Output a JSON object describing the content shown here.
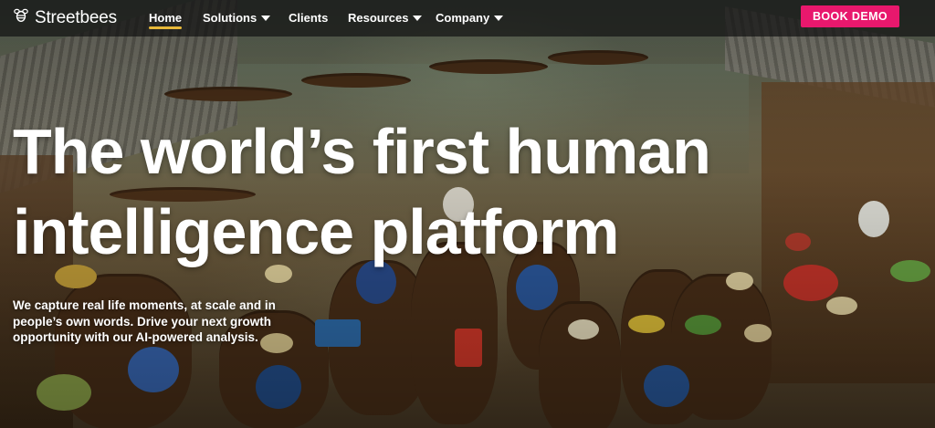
{
  "brand": {
    "name": "Streetbees",
    "logo_icon": "bee-icon"
  },
  "nav": {
    "items": [
      {
        "label": "Home",
        "active": true,
        "dropdown": false
      },
      {
        "label": "Solutions",
        "active": false,
        "dropdown": true
      },
      {
        "label": "Clients",
        "active": false,
        "dropdown": false
      },
      {
        "label": "Resources",
        "active": false,
        "dropdown": true
      },
      {
        "label": "Company",
        "active": false,
        "dropdown": true
      }
    ],
    "cta_label": "BOOK DEMO",
    "colors": {
      "cta": "#e8186d",
      "active_underline": "#e8b93a"
    }
  },
  "hero": {
    "headline_line1": "The world’s first human",
    "headline_line2": "intelligence platform",
    "subtext": "We capture real life moments, at scale and in people’s own words. Drive your next growth opportunity with our AI-powered analysis.",
    "background": "floating-market-photo"
  }
}
